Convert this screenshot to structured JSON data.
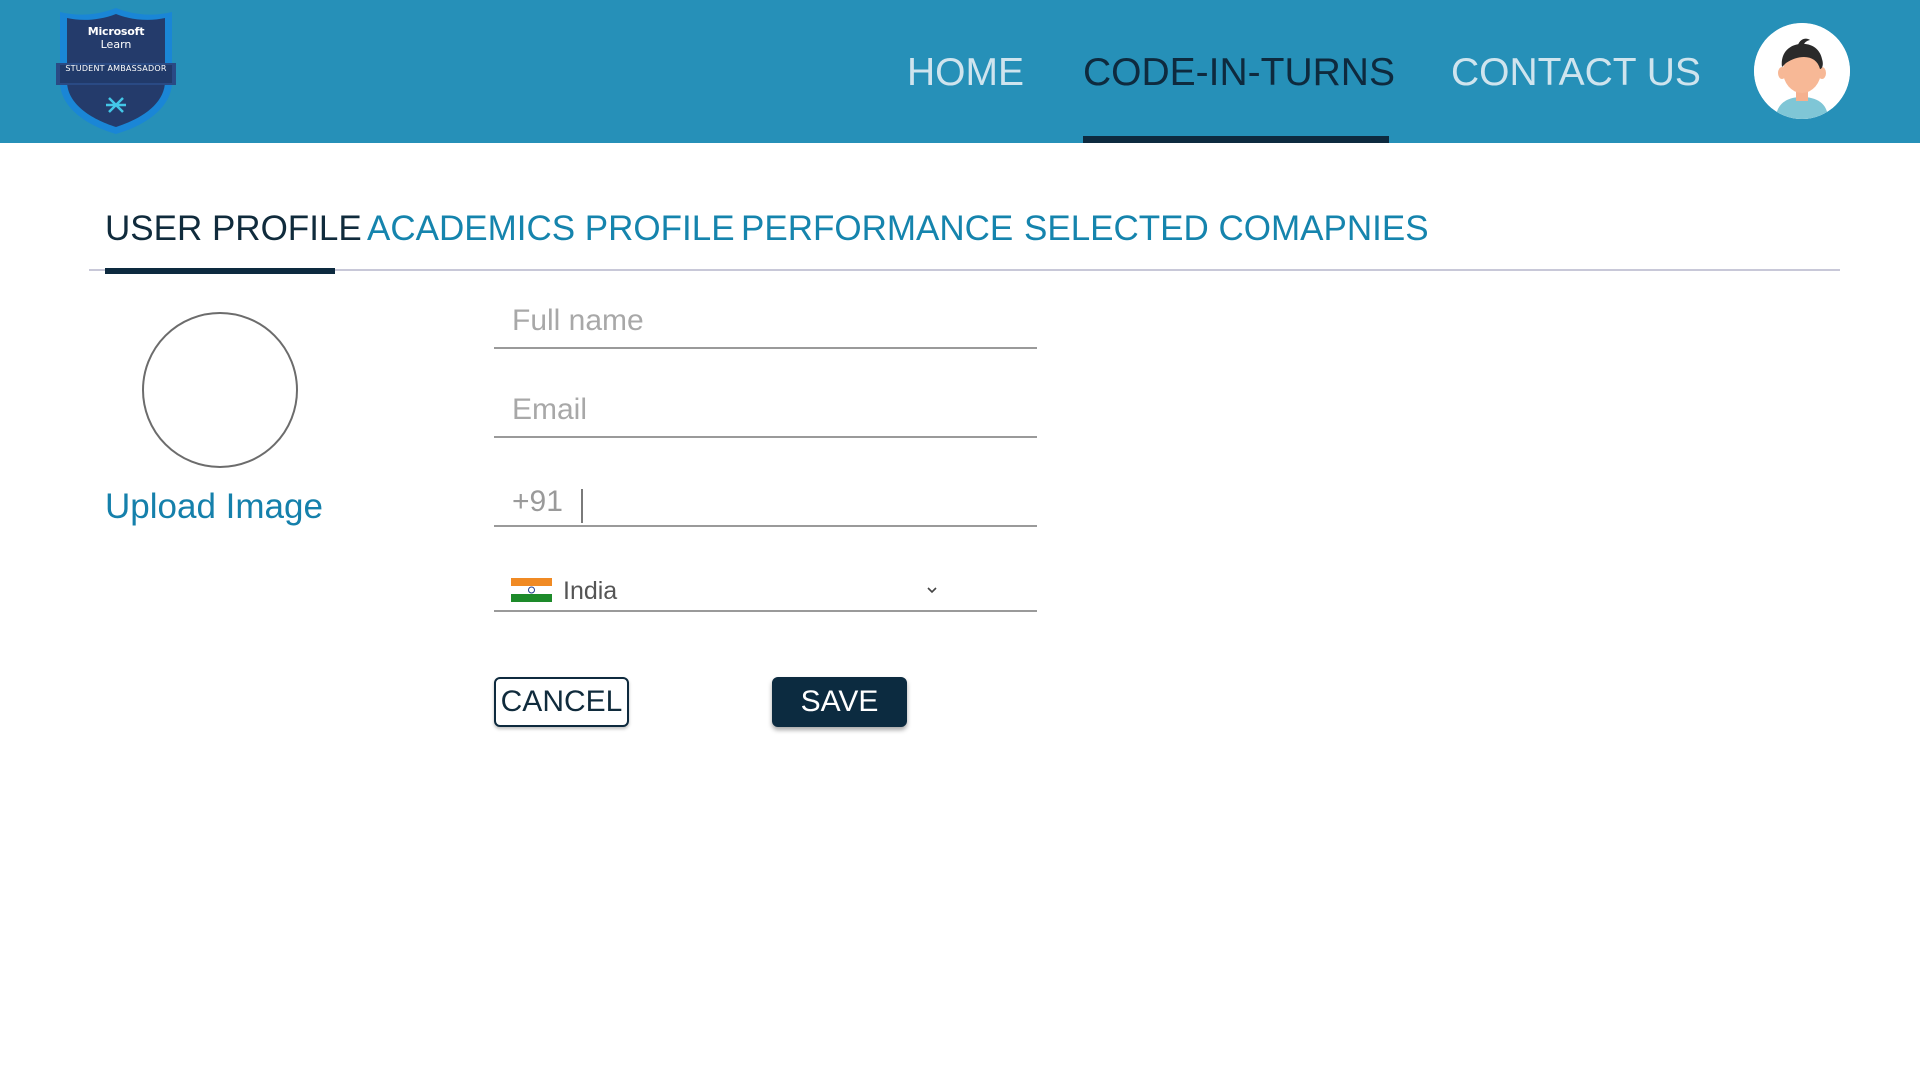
{
  "header": {
    "logo": {
      "line1": "Microsoft",
      "line2": "Learn",
      "line3": "STUDENT AMBASSADOR",
      "icon": "microsoft-learn-student-ambassador-badge"
    },
    "nav": [
      {
        "label": "HOME",
        "active": false
      },
      {
        "label": "CODE-IN-TURNS",
        "active": true
      },
      {
        "label": "CONTACT US",
        "active": false
      }
    ],
    "avatar_icon": "user-avatar-icon",
    "colors": {
      "bar": "#2690b8",
      "active": "#0d2a3f",
      "inactive_text": "#cfe4ee"
    }
  },
  "tabs": [
    {
      "label": "USER PROFILE",
      "active": true
    },
    {
      "label": "ACADEMICS PROFILE",
      "active": false
    },
    {
      "label": "PERFORMANCE",
      "active": false
    },
    {
      "label": "SELECTED COMAPNIES",
      "active": false
    }
  ],
  "profile_image": {
    "upload_label": "Upload Image"
  },
  "form": {
    "full_name": {
      "placeholder": "Full name",
      "value": ""
    },
    "email": {
      "placeholder": "Email",
      "value": ""
    },
    "phone": {
      "prefix": "+91",
      "value": ""
    },
    "country": {
      "selected": "India",
      "flag_icon": "india-flag-icon"
    }
  },
  "buttons": {
    "cancel": "CANCEL",
    "save": "SAVE"
  },
  "accent_colors": {
    "link": "#1584ad",
    "dark": "#0c2b40"
  }
}
